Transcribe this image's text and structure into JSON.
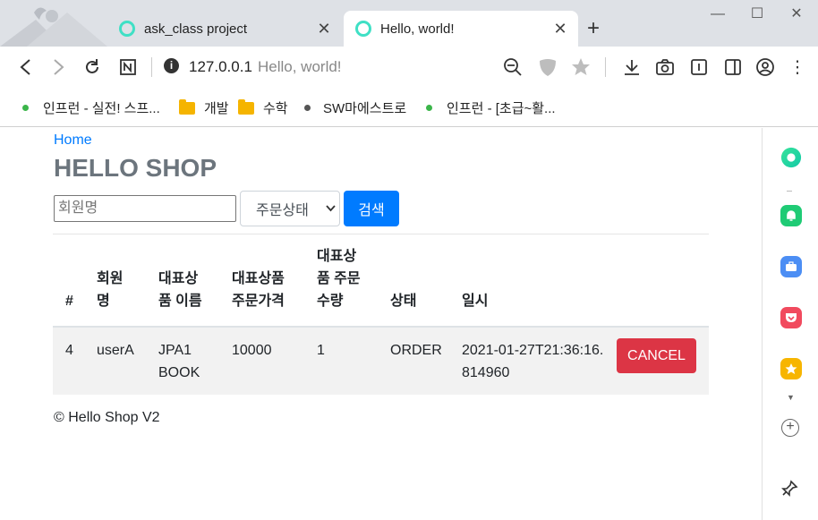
{
  "browser": {
    "tabs": [
      {
        "title": "ask_class project",
        "active": false
      },
      {
        "title": "Hello, world!",
        "active": true
      }
    ],
    "new_tab": "+",
    "url_host": "127.0.0.1",
    "url_page_title": "Hello, world!",
    "bookmarks": [
      {
        "label": "인프런 - 실전! 스프...",
        "icon": "green-dot"
      },
      {
        "label": "개발",
        "icon": "folder-icon"
      },
      {
        "label": "수학",
        "icon": "folder-icon"
      },
      {
        "label": "SW마에스트로",
        "icon": "dark-dot"
      },
      {
        "label": "인프런 - [초급~활...",
        "icon": "green-dot"
      }
    ]
  },
  "page": {
    "breadcrumb": "Home",
    "title": "HELLO SHOP",
    "search": {
      "member_placeholder": "회원명",
      "status_selected": "주문상태",
      "button_label": "검색"
    },
    "table": {
      "headers": [
        "#",
        "회원명",
        "대표상품 이름",
        "대표상품 주문가격",
        "대표상품 주문수량",
        "상태",
        "일시",
        ""
      ],
      "header_lines": [
        [
          "#"
        ],
        [
          "회원",
          "명"
        ],
        [
          "대표상",
          "품 이름"
        ],
        [
          "대표상품",
          "주문가격"
        ],
        [
          "대표상",
          "품 주문",
          "수량"
        ],
        [
          "상태"
        ],
        [
          "일시"
        ],
        [
          ""
        ]
      ],
      "rows": [
        {
          "id": "4",
          "member": "userA",
          "item_name": "JPA1 BOOK",
          "price": "10000",
          "count": "1",
          "status": "ORDER",
          "date": "2021-01-27T21:36:16.814960",
          "action": "CANCEL"
        }
      ]
    },
    "footer": "© Hello Shop V2"
  },
  "colors": {
    "primary": "#007bff",
    "danger": "#dc3545",
    "title_gray": "#6c757d",
    "tab_ring": "#3fe0c5"
  }
}
